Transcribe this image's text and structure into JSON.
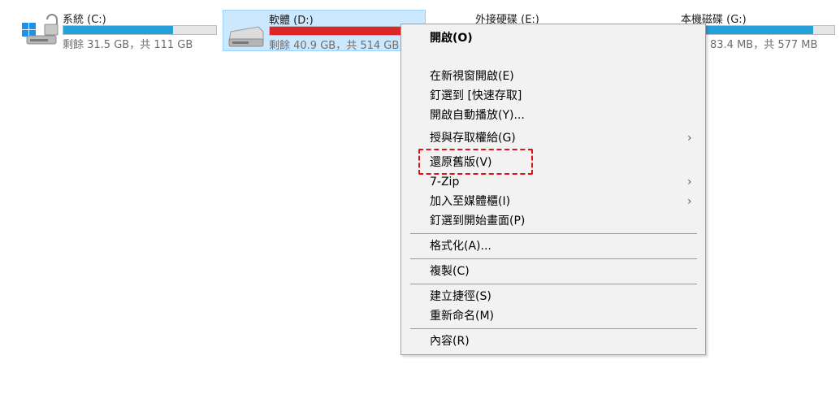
{
  "drives": [
    {
      "name": "系統 (C:)",
      "free_text": "剩餘 31.5 GB，共 111 GB",
      "used_fraction": 0.72,
      "bar_color": "#26a0da",
      "icon": "windows-system-drive-icon"
    },
    {
      "name": "軟體 (D:)",
      "free_text": "剩餘 40.9 GB，共 514 GB",
      "used_fraction": 0.92,
      "bar_color": "#da2626",
      "icon": "hard-drive-icon"
    },
    {
      "name": "外接硬碟 (E:)",
      "free_text": "",
      "used_fraction": null,
      "bar_color": "#26a0da",
      "icon": "external-drive-icon"
    },
    {
      "name": "本機磁碟 (G:)",
      "free_text": "83.4 MB，共 577 MB",
      "used_fraction": 0.86,
      "bar_color": "#26a0da",
      "icon": "local-disk-icon"
    }
  ],
  "context_menu": {
    "items": [
      {
        "label": "開啟(O)",
        "bold": true
      },
      {
        "label": "在新視窗開啟(E)"
      },
      {
        "label": "釘選到 [快速存取]"
      },
      {
        "label": "開啟自動播放(Y)..."
      },
      {
        "label": "授與存取權給(G)",
        "submenu": true
      },
      {
        "label": "還原舊版(V)",
        "highlighted": true
      },
      {
        "label": "7-Zip",
        "submenu": true
      },
      {
        "label": "加入至媒體櫃(I)",
        "submenu": true
      },
      {
        "label": "釘選到開始畫面(P)"
      },
      {
        "label": "格式化(A)..."
      },
      {
        "label": "複製(C)"
      },
      {
        "label": "建立捷徑(S)"
      },
      {
        "label": "重新命名(M)"
      },
      {
        "label": "內容(R)"
      }
    ],
    "submenu_arrow": "›",
    "highlight_color": "#e0111b",
    "background": "#f2f2f2"
  }
}
